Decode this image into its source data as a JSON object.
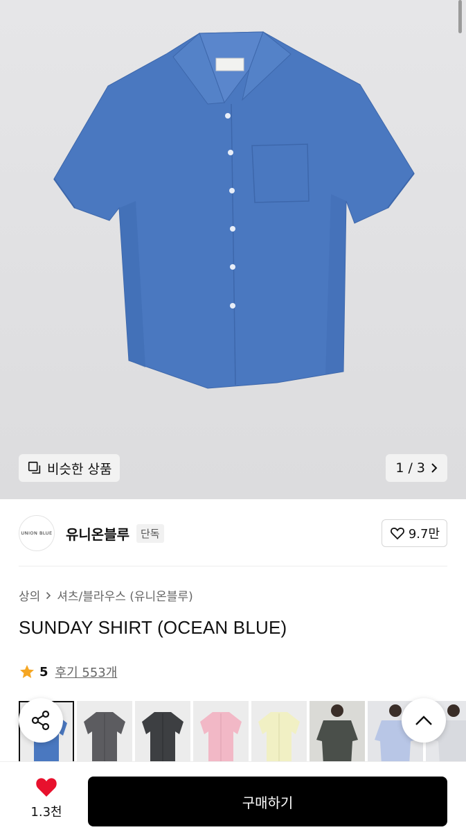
{
  "gallery": {
    "similar_label": "비슷한 상품",
    "pager": "1 / 3",
    "shirt_color": "#4a78c0"
  },
  "brand": {
    "logo_text": "UNION BLUE",
    "name": "유니온블루",
    "tag": "단독",
    "likes": "9.7만"
  },
  "product": {
    "breadcrumb": [
      "상의",
      "셔츠/블라우스 (유니온블루)"
    ],
    "title": "SUNDAY SHIRT (OCEAN BLUE)",
    "rating": "5",
    "reviews": "후기 553개"
  },
  "thumbnails": [
    {
      "color": "#4a78c0",
      "selected": true
    },
    {
      "color": "#5c5c60"
    },
    {
      "color": "#3d3f42"
    },
    {
      "color": "#f2b8c6"
    },
    {
      "color": "#f1f0c4"
    },
    {
      "color": "#4a4f4a",
      "model": true
    },
    {
      "color": "#b8c6e6",
      "model": true
    },
    {
      "color": "#d8dadf",
      "model": true
    }
  ],
  "bottom": {
    "wish_count": "1.3천",
    "buy_label": "구매하기"
  },
  "colors": {
    "accent": "#000000",
    "heart": "#e8112d",
    "star": "#f5a623"
  }
}
